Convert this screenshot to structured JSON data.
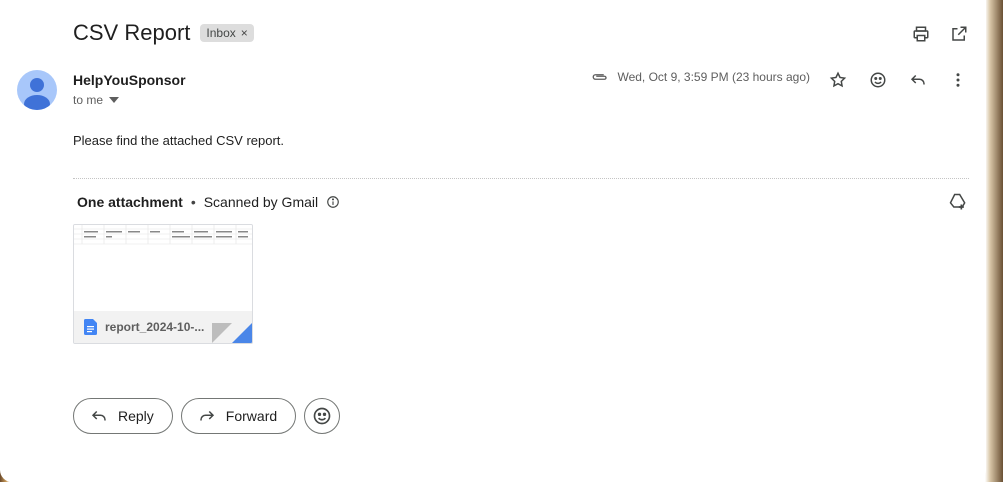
{
  "subject": "CSV Report",
  "label": "Inbox",
  "label_close": "×",
  "sender": {
    "name": "HelpYouSponsor",
    "to": "to me"
  },
  "meta": {
    "date": "Wed, Oct 9, 3:59 PM (23 hours ago)"
  },
  "body": "Please find the attached CSV report.",
  "attachments": {
    "heading": "One attachment",
    "separator": "•",
    "scanned": "Scanned by Gmail",
    "file_name": "report_2024-10-..."
  },
  "actions": {
    "reply": "Reply",
    "forward": "Forward"
  },
  "icons": {
    "print": "print-icon",
    "open_new": "open-in-new-window-icon",
    "attachment": "paperclip-icon",
    "star": "star-icon",
    "emoji": "emoji-icon",
    "reply": "reply-icon",
    "more": "more-vert-icon",
    "info": "info-icon",
    "drive": "add-to-drive-icon",
    "doc": "document-icon"
  },
  "colors": {
    "avatar": "#a8c7fa",
    "avatar_figure": "#3f72d8",
    "doc_icon": "#4285f4"
  }
}
